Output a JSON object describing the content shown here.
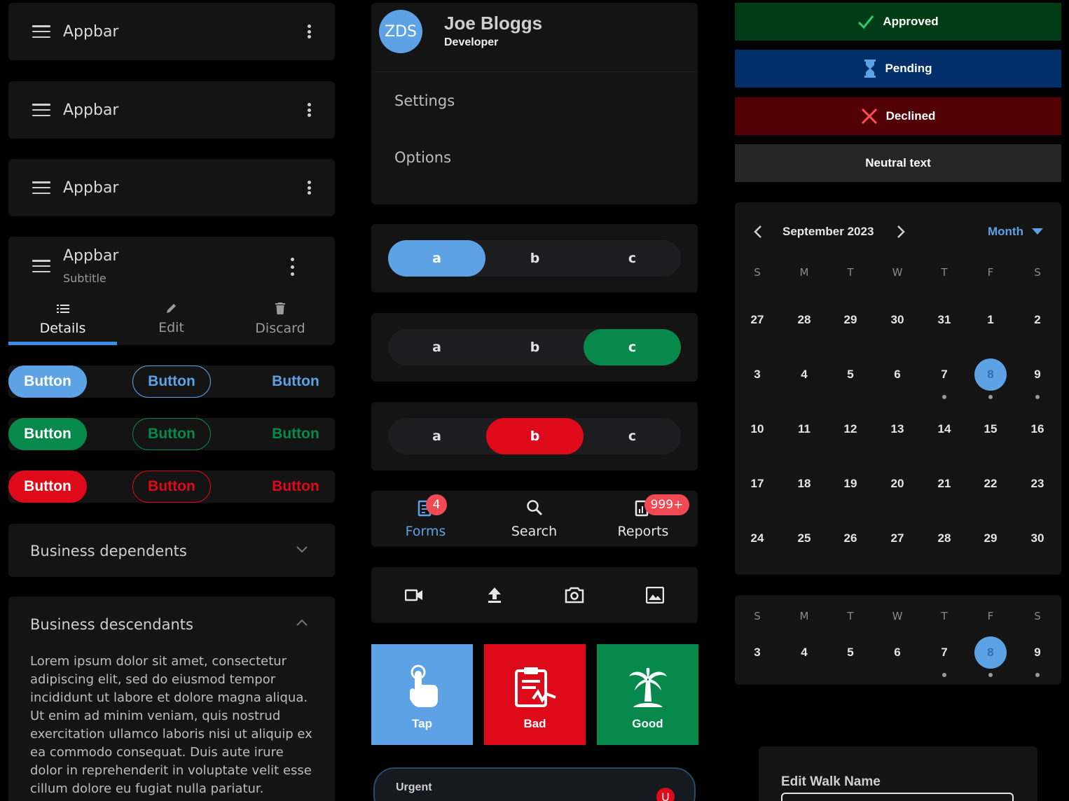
{
  "appbars": [
    {
      "title": "Appbar"
    },
    {
      "title": "Appbar"
    },
    {
      "title": "Appbar"
    }
  ],
  "appbar_tabs": {
    "title": "Appbar",
    "subtitle": "Subtitle",
    "tabs": [
      {
        "label": "Details",
        "icon": "list-icon"
      },
      {
        "label": "Edit",
        "icon": "pencil-icon"
      },
      {
        "label": "Discard",
        "icon": "trash-icon"
      }
    ],
    "active_tab": "Details"
  },
  "buttons": [
    {
      "color": "#5ea2e6",
      "filled": "Button",
      "outline": "Button",
      "text": "Button"
    },
    {
      "color": "#06894a",
      "filled": "Button",
      "outline": "Button",
      "text": "Button"
    },
    {
      "color": "#de0a1a",
      "filled": "Button",
      "outline": "Button",
      "text": "Button"
    }
  ],
  "accordions": {
    "collapsed": {
      "title": "Business dependents"
    },
    "expanded": {
      "title": "Business descendants",
      "body": "Lorem ipsum dolor sit amet, consectetur adipiscing elit, sed do eiusmod tempor incididunt ut labore et dolore magna aliqua. Ut enim ad minim veniam, quis nostrud exercitation ullamco laboris nisi ut aliquip ex ea commodo consequat. Duis aute irure dolor in reprehenderit in voluptate velit esse cillum dolore eu fugiat nulla pariatur."
    }
  },
  "profile": {
    "initials": "ZDS",
    "name": "Joe Bloggs",
    "role": "Developer",
    "menu": [
      "Settings",
      "Options"
    ]
  },
  "segmented": [
    {
      "options": [
        "a",
        "b",
        "c"
      ],
      "selected": 0,
      "color": "#5ea2e6"
    },
    {
      "options": [
        "a",
        "b",
        "c"
      ],
      "selected": 2,
      "color": "#06894a"
    },
    {
      "options": [
        "a",
        "b",
        "c"
      ],
      "selected": 1,
      "color": "#de0a1a"
    }
  ],
  "bottom_nav": {
    "items": [
      {
        "label": "Forms",
        "icon": "forms-icon",
        "badge": "4",
        "active": true
      },
      {
        "label": "Search",
        "icon": "search-icon",
        "badge": ""
      },
      {
        "label": "Reports",
        "icon": "reports-icon",
        "badge": "999+"
      }
    ]
  },
  "toolbar_icons": [
    "video-camera-icon",
    "upload-icon",
    "camera-icon",
    "image-icon"
  ],
  "tiles": [
    {
      "label": "Tap",
      "icon": "tap-icon",
      "color": "#5ea2e6"
    },
    {
      "label": "Bad",
      "icon": "clipboard-pulse-icon",
      "color": "#de0a1a"
    },
    {
      "label": "Good",
      "icon": "palm-tree-icon",
      "color": "#06894a"
    }
  ],
  "urgent": {
    "label": "Urgent",
    "avatar": "U"
  },
  "statuses": [
    {
      "label": "Approved",
      "icon": "check-icon",
      "bg": "#003d17"
    },
    {
      "label": "Pending",
      "icon": "hourglass-icon",
      "bg": "#002f6a"
    },
    {
      "label": "Declined",
      "icon": "cross-icon",
      "bg": "#520006"
    },
    {
      "label": "Neutral text",
      "icon": "",
      "bg": "#262626"
    }
  ],
  "calendar": {
    "month_label": "September 2023",
    "view": "Month",
    "weekdays": [
      "S",
      "M",
      "T",
      "W",
      "T",
      "F",
      "S"
    ],
    "weeks": [
      [
        "27",
        "28",
        "29",
        "30",
        "31",
        "1",
        "2"
      ],
      [
        "3",
        "4",
        "5",
        "6",
        "7",
        "8",
        "9"
      ],
      [
        "10",
        "11",
        "12",
        "13",
        "14",
        "15",
        "16"
      ],
      [
        "17",
        "18",
        "19",
        "20",
        "21",
        "22",
        "23"
      ],
      [
        "24",
        "25",
        "26",
        "27",
        "28",
        "29",
        "30"
      ]
    ],
    "selected": "8",
    "accent": "#5ea2e6"
  },
  "week_calendar": {
    "weekdays": [
      "S",
      "M",
      "T",
      "W",
      "T",
      "F",
      "S"
    ],
    "days": [
      "3",
      "4",
      "5",
      "6",
      "7",
      "8",
      "9"
    ],
    "selected": "8"
  },
  "edit_walk": {
    "label": "Edit Walk Name"
  }
}
